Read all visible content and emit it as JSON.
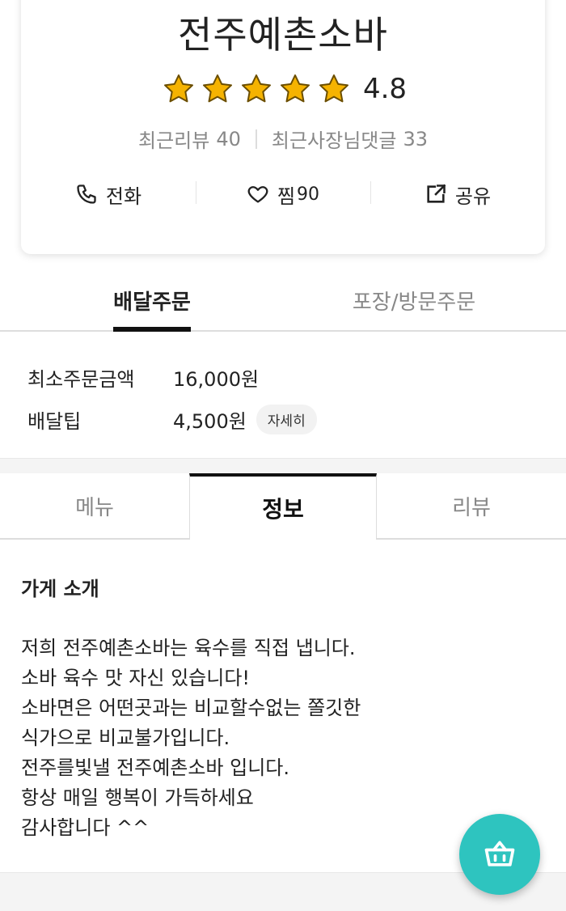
{
  "store": {
    "name": "전주예촌소바",
    "rating": "4.8",
    "stars": 5,
    "recent_reviews_label": "최근리뷰",
    "recent_reviews_count": "40",
    "owner_replies_label": "최근사장님댓글",
    "owner_replies_count": "33"
  },
  "actions": {
    "call_label": "전화",
    "favorite_label": "찜",
    "favorite_count": "90",
    "share_label": "공유"
  },
  "order_tabs": {
    "delivery": "배달주문",
    "pickup": "포장/방문주문"
  },
  "delivery_info": {
    "min_order_label": "최소주문금액",
    "min_order_value": "16,000원",
    "tip_label": "배달팁",
    "tip_value": "4,500원",
    "detail_label": "자세히"
  },
  "info_tabs": {
    "menu": "메뉴",
    "info": "정보",
    "review": "리뷰"
  },
  "intro": {
    "title": "가게 소개",
    "lines": [
      "저희 전주예촌소바는 육수를 직접 냅니다.",
      "소바 육수 맛 자신 있습니다!",
      "소바면은 어떤곳과는 비교할수없는 쫄깃한",
      "식가으로 비교불가입니다.",
      "전주를빛낼 전주예촌소바 입니다.",
      "항상 매일 행복이 가득하세요",
      "감사합니다 ^^"
    ]
  },
  "colors": {
    "accent": "#2ec4bf",
    "star": "#f5b301",
    "muted": "#888888"
  }
}
